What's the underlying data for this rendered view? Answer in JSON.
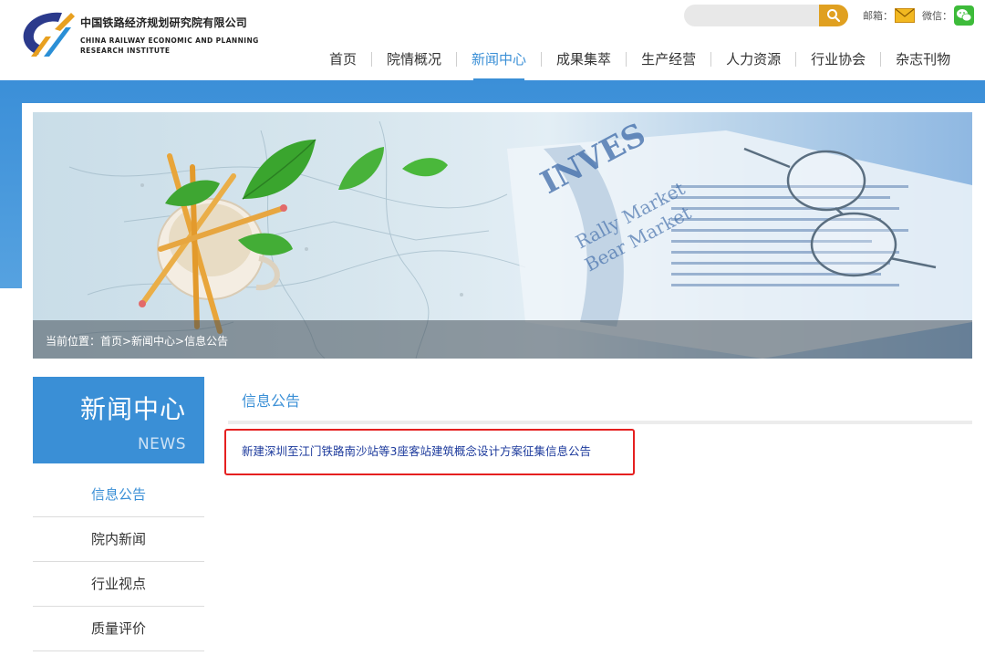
{
  "header": {
    "logo_cn": "中国铁路经济规划研究院有限公司",
    "logo_en_line1": "CHINA RAILWAY ECONOMIC AND PLANNING",
    "logo_en_line2": "RESEARCH INSTITUTE",
    "search_placeholder": "",
    "mail_label": "邮箱：",
    "wechat_label": "微信：",
    "brand_color": "#3a8fd6",
    "search_color": "#e0a020"
  },
  "nav": [
    {
      "label": "首页"
    },
    {
      "label": "院情概况"
    },
    {
      "label": "新闻中心",
      "active": true
    },
    {
      "label": "成果集萃"
    },
    {
      "label": "生产经营"
    },
    {
      "label": "人力资源"
    },
    {
      "label": "行业协会"
    },
    {
      "label": "杂志刊物"
    }
  ],
  "banner": {
    "breadcrumb": "当前位置：首页>新闻中心>信息公告",
    "newspaper_text": "INVEST Rally Market Bear Market"
  },
  "sidebar": {
    "title": "新闻中心",
    "title_en": "NEWS",
    "items": [
      {
        "label": "信息公告",
        "active": true
      },
      {
        "label": "院内新闻"
      },
      {
        "label": "行业视点"
      },
      {
        "label": "质量评价"
      }
    ]
  },
  "main": {
    "title": "信息公告",
    "news": [
      {
        "title": "新建深圳至江门铁路南沙站等3座客站建筑概念设计方案征集信息公告"
      }
    ],
    "highlight_color": "#e52020"
  }
}
